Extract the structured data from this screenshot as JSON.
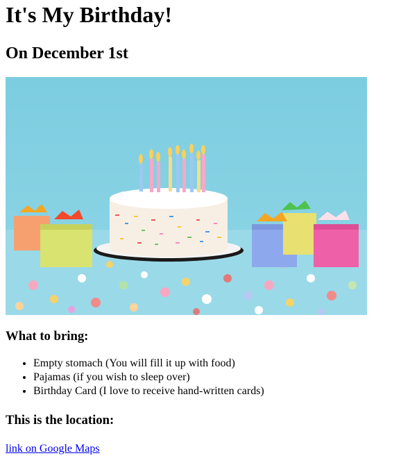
{
  "page": {
    "title": "It's My Birthday!",
    "subtitle": "On December 1st"
  },
  "image": {
    "icon": "birthday-cake-photo"
  },
  "bring": {
    "heading": "What to bring:",
    "items": [
      "Empty stomach (You will fill it up with food)",
      "Pajamas (if you wish to sleep over)",
      "Birthday Card (I love to receive hand-written cards)"
    ]
  },
  "location": {
    "heading": "This is the location:",
    "link_text": "link on Google Maps"
  },
  "colors": {
    "link": "#0000ee",
    "photo_background": "#7fcfe0"
  }
}
